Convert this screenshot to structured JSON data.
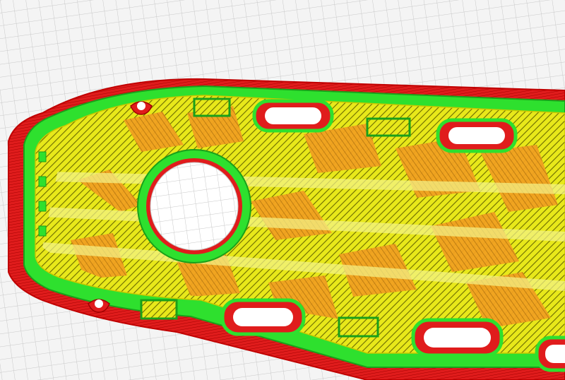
{
  "viewport": {
    "scene": "slicer-layer-preview",
    "background_color": "#f4f4f4",
    "grid_color": "#c8c8c8",
    "grid_major_color": "#9a9a9a"
  },
  "legend_colors": {
    "outer_wall": "#e01c1c",
    "inner_wall": "#2ee02e",
    "skin": "#e8e81a",
    "infill": "#f0a020",
    "travel_hatch": "#6b6b00"
  },
  "icons": {
    "hang_hole": "keyhole-icon",
    "handle_slot": "slot-icon",
    "center_hole": "circle-icon"
  }
}
